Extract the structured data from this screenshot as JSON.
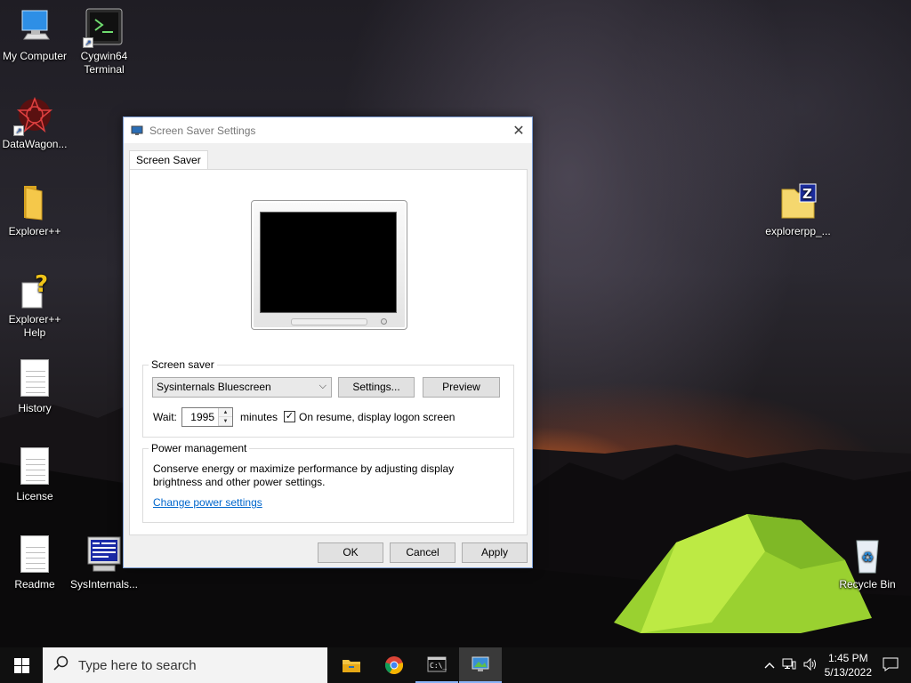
{
  "desktop": {
    "icons": [
      {
        "label": "My Computer",
        "icon": "computer-icon"
      },
      {
        "label": "Cygwin64\nTerminal",
        "icon": "terminal-icon"
      },
      {
        "label": "DataWagon...",
        "icon": "datawagon-icon"
      },
      {
        "label": "Explorer++",
        "icon": "folder-icon"
      },
      {
        "label": "Explorer++\nHelp",
        "icon": "help-icon"
      },
      {
        "label": "History",
        "icon": "document-icon"
      },
      {
        "label": "License",
        "icon": "document-icon"
      },
      {
        "label": "Readme",
        "icon": "document-icon"
      },
      {
        "label": "SysInternals...",
        "icon": "sysinternals-icon"
      },
      {
        "label": "explorerpp_...",
        "icon": "zip-folder-icon"
      },
      {
        "label": "Recycle Bin",
        "icon": "recycle-bin-icon"
      }
    ]
  },
  "dialog": {
    "title": "Screen Saver Settings",
    "close_glyph": "✕",
    "tab_label": "Screen Saver",
    "screensaver_group": {
      "legend": "Screen saver",
      "selected": "Sysinternals Bluescreen",
      "settings_label": "Settings...",
      "preview_label": "Preview",
      "wait_label": "Wait:",
      "wait_value": "1995",
      "minutes_label": "minutes",
      "resume_checked": true,
      "resume_label": "On resume, display logon screen"
    },
    "power_group": {
      "legend": "Power management",
      "description_line1": "Conserve energy or maximize performance by adjusting display",
      "description_line2": "brightness and other power settings.",
      "link": "Change power settings"
    },
    "buttons": {
      "ok": "OK",
      "cancel": "Cancel",
      "apply": "Apply"
    }
  },
  "taskbar": {
    "search_placeholder": "Type here to search",
    "time": "1:45 PM",
    "date": "5/13/2022",
    "accent_color": "#8ab4f8"
  }
}
